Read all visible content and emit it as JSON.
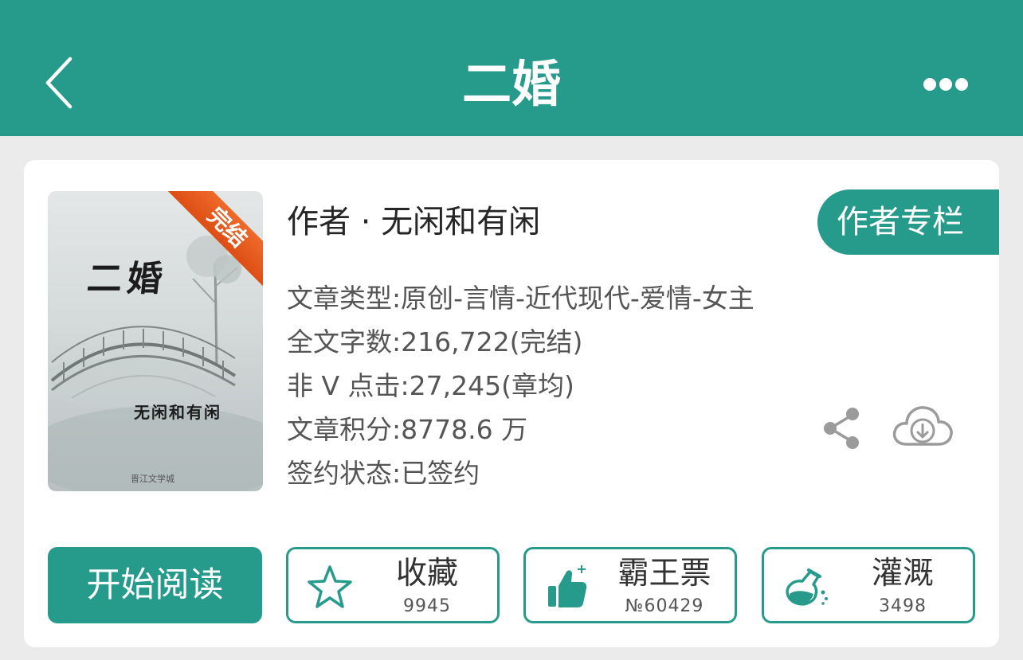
{
  "header": {
    "title": "二婚",
    "back_icon": "chevron-left-icon",
    "more_icon": "more-horizontal-icon"
  },
  "book": {
    "cover": {
      "title": "二婚",
      "author": "无闲和有闲",
      "publisher": "晋江文学城",
      "status_ribbon": "完结"
    },
    "author_line": "作者 · 无闲和有闲",
    "author_column_label": "作者专栏",
    "meta": [
      "文章类型:原创-言情-近代现代-爱情-女主",
      "全文字数:216,722(完结)",
      "非 V 点击:27,245(章均)",
      "文章积分:8778.6 万",
      "签约状态:已签约"
    ]
  },
  "actions": {
    "read_label": "开始阅读",
    "favorite": {
      "label": "收藏",
      "count": "9945",
      "icon": "star-icon"
    },
    "vote": {
      "label": "霸王票",
      "count": "№60429",
      "icon": "thumbs-up-icon"
    },
    "nutrient": {
      "label": "灌溉",
      "count": "3498",
      "icon": "flask-icon"
    }
  },
  "icons": {
    "share": "share-icon",
    "download": "cloud-download-icon"
  },
  "colors": {
    "primary": "#279b8b",
    "ribbon": "#e55a1c",
    "background": "#ebebeb",
    "card": "#ffffff"
  }
}
